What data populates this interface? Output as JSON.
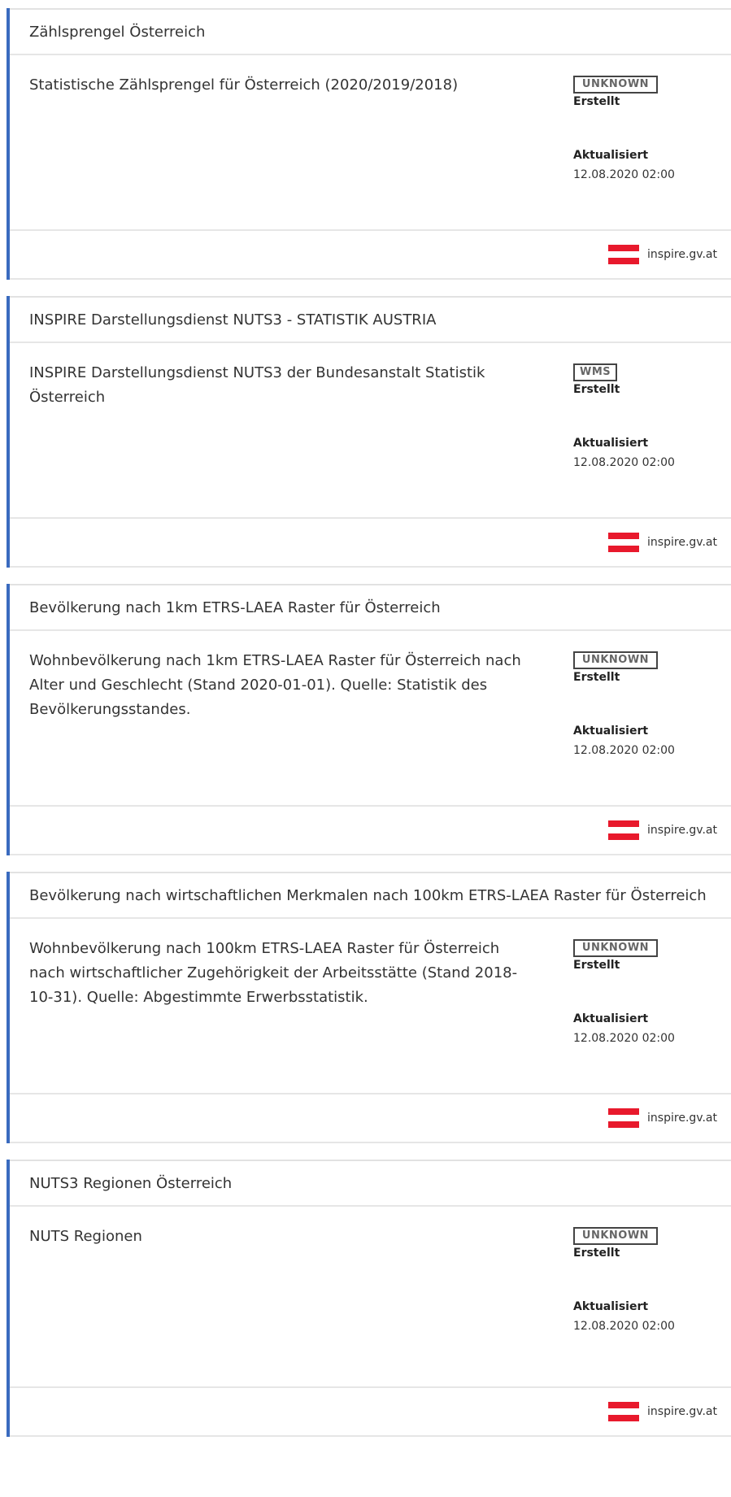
{
  "colors": {
    "accent": "#3a6bbf",
    "flag_red": "#e8192c",
    "flag_white": "#ffffff"
  },
  "labels": {
    "created": "Erstellt",
    "updated": "Aktualisiert"
  },
  "items": [
    {
      "title": "Zählsprengel Österreich",
      "description": "Statistische Zählsprengel für Österreich (2020/2019/2018)",
      "type": "UNKNOWN",
      "updated": "12.08.2020 02:00",
      "source": "inspire.gv.at",
      "source_icon": "austria-flag-icon"
    },
    {
      "title": "INSPIRE Darstellungsdienst NUTS3 - STATISTIK AUSTRIA",
      "description": "INSPIRE Darstellungsdienst NUTS3 der Bundesanstalt Statistik Österreich",
      "type": "WMS",
      "updated": "12.08.2020 02:00",
      "source": "inspire.gv.at",
      "source_icon": "austria-flag-icon"
    },
    {
      "title": "Bevölkerung nach 1km ETRS-LAEA Raster für Österreich",
      "description": "Wohnbevölkerung nach 1km ETRS-LAEA Raster für Österreich nach Alter und Geschlecht (Stand 2020-01-01). Quelle: Statistik des Bevölkerungsstandes.",
      "type": "UNKNOWN",
      "updated": "12.08.2020 02:00",
      "source": "inspire.gv.at",
      "source_icon": "austria-flag-icon"
    },
    {
      "title": "Bevölkerung nach wirtschaftlichen Merkmalen nach 100km ETRS-LAEA Raster für Österreich",
      "description": "Wohnbevölkerung nach 100km ETRS-LAEA Raster für Österreich nach wirtschaftlicher Zugehörigkeit der Arbeitsstätte (Stand 2018-10-31). Quelle: Abgestimmte Erwerbsstatistik.",
      "type": "UNKNOWN",
      "updated": "12.08.2020 02:00",
      "source": "inspire.gv.at",
      "source_icon": "austria-flag-icon"
    },
    {
      "title": "NUTS3 Regionen Österreich",
      "description": "NUTS Regionen",
      "type": "UNKNOWN",
      "updated": "12.08.2020 02:00",
      "source": "inspire.gv.at",
      "source_icon": "austria-flag-icon"
    }
  ]
}
